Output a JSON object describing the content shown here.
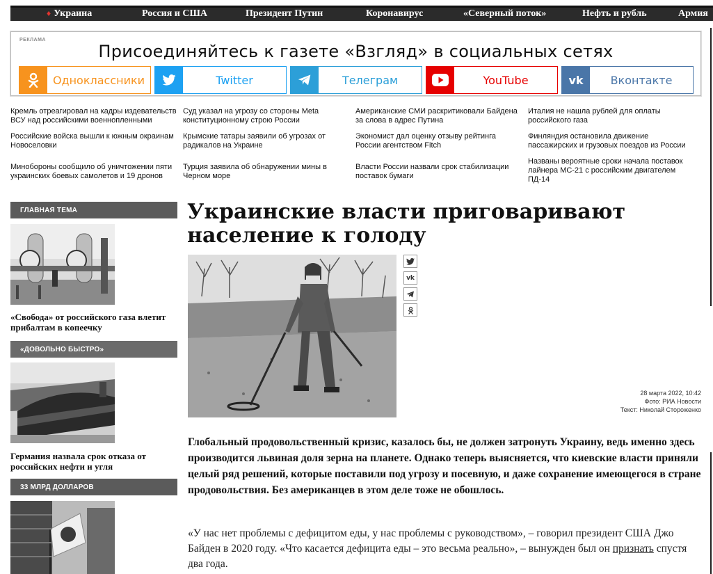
{
  "topnav": {
    "items": [
      "Украина",
      "Россия и США",
      "Президент Путин",
      "Коронавирус",
      "«Северный поток»",
      "Нефть и рубль",
      "Армия"
    ]
  },
  "ad": {
    "label": "РЕКЛАМА",
    "title": "Присоединяйтесь к газете «Взгляд» в социальных сетях",
    "buttons": [
      {
        "label": "Одноклассники",
        "icon": "ok-icon",
        "color": "#f7931e"
      },
      {
        "label": "Twitter",
        "icon": "twitter-icon",
        "color": "#1da1f2"
      },
      {
        "label": "Телеграм",
        "icon": "telegram-icon",
        "color": "#2c9fd8"
      },
      {
        "label": "YouTube",
        "icon": "youtube-icon",
        "color": "#e60000"
      },
      {
        "label": "Вконтакте",
        "icon": "vk-icon",
        "color": "#4a76a8"
      }
    ]
  },
  "news": [
    "Кремль отреагировал на кадры издевательств ВСУ над российскими военнопленными",
    "Суд указал на угрозу со стороны Meta конституционному строю России",
    "Американские СМИ раскритиковали Байдена за слова в адрес Путина",
    "Италия не нашла рублей для оплаты российского газа",
    "Российские войска вышли к южным окраинам Новоселовки",
    "Крымские татары заявили об угрозах от радикалов на Украине",
    "Экономист дал оценку отзыву рейтинга России агентством Fitch",
    "Финляндия остановила движение пассажирских и грузовых поездов из России",
    "Минобороны сообщило об уничтожении пяти украинских боевых самолетов и 19 дронов",
    "Турция заявила об обнаружении мины в Черном море",
    "Власти России назвали срок стабилизации поставок бумаги",
    "Названы вероятные сроки начала поставок лайнера МС-21 с российским двигателем ПД-14"
  ],
  "sidebar": [
    {
      "section": "ГЛАВНАЯ ТЕМА",
      "caption": "«Свобода» от российского газа влетит прибалтам в копеечку"
    },
    {
      "section": "«ДОВОЛЬНО БЫСТРО»",
      "caption": "Германия назвала срок отказа от российских нефти и угля"
    },
    {
      "section": "33 МЛРД ДОЛЛАРОВ",
      "caption": ""
    }
  ],
  "article": {
    "title": "Украинские власти приговаривают население к голоду",
    "date": "28 марта 2022, 10:42",
    "photo_credit": "Фото: РИА Новости",
    "text_credit": "Текст: Николай Стороженко",
    "lead": "Глобальный продовольственный кризис, казалось бы, не должен затронуть Украину, ведь именно здесь производится львиная доля зерна на планете. Однако теперь выясняется, что киевские власти приняли целый ряд решений, которые поставили под угрозу и посевную, и даже сохранение имеющегося в стране продовольствия. Без американцев в этом деле тоже не обошлось.",
    "body_before": "«У нас нет проблемы с дефицитом еды, у нас проблемы с руководством», – говорил президент США Джо Байден в 2020 году. «Что касается дефицита еды – это весьма реально», – вынужден был он ",
    "body_link": "признать",
    "body_after": " спустя два года."
  },
  "share_icons": [
    "twitter-icon",
    "vk-icon",
    "telegram-icon",
    "ok-icon"
  ]
}
